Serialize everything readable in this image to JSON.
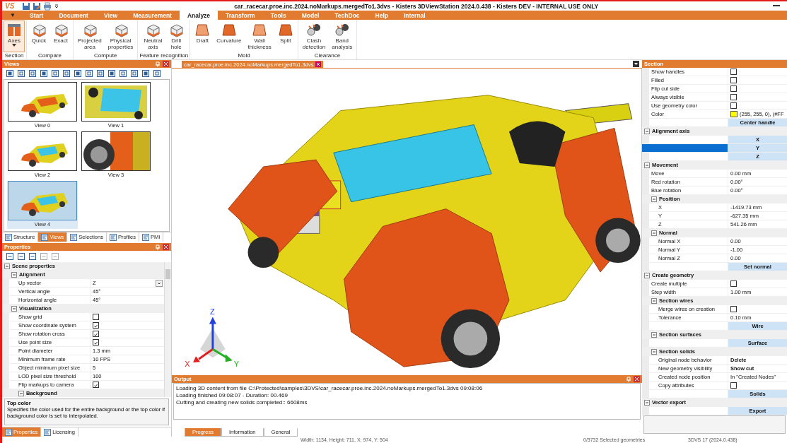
{
  "window": {
    "logo": "VS",
    "title": "car_racecar.proe.inc.2024.noMarkups.mergedTo1.3dvs - Kisters 3DViewStation 2024.0.438 - Kisters DEV - INTERNAL USE ONLY"
  },
  "menu": {
    "app_menu": "▼",
    "tabs": [
      {
        "label": "Start",
        "selected": false
      },
      {
        "label": "Document",
        "selected": false
      },
      {
        "label": "View",
        "selected": false
      },
      {
        "label": "Measurement",
        "selected": false
      },
      {
        "label": "Analyze",
        "selected": true
      },
      {
        "label": "Transform",
        "selected": false
      },
      {
        "label": "Tools",
        "selected": false
      },
      {
        "label": "Model",
        "selected": false
      },
      {
        "label": "TechDoc",
        "selected": false
      },
      {
        "label": "Help",
        "selected": false
      },
      {
        "label": "Internal",
        "selected": false
      }
    ]
  },
  "ribbon": [
    {
      "label": "Section",
      "buttons": [
        {
          "label": "Axes",
          "dropdown": true,
          "selected": true
        }
      ]
    },
    {
      "label": "Compare",
      "buttons": [
        {
          "label": "Quick",
          "dropdown": false,
          "selected": false
        },
        {
          "label": "Exact",
          "dropdown": false,
          "selected": false
        }
      ]
    },
    {
      "label": "Compute",
      "buttons": [
        {
          "label": "Projected\narea",
          "dropdown": false,
          "selected": false
        },
        {
          "label": "Physical\nproperties",
          "dropdown": false,
          "selected": false
        }
      ]
    },
    {
      "label": "Feature recognition",
      "buttons": [
        {
          "label": "Neutral\naxis",
          "dropdown": false,
          "selected": false
        },
        {
          "label": "Drill\nhole",
          "dropdown": false,
          "selected": false
        }
      ]
    },
    {
      "label": "Mold",
      "buttons": [
        {
          "label": "Draft",
          "dropdown": false,
          "selected": false
        },
        {
          "label": "Curvature",
          "dropdown": false,
          "selected": false
        },
        {
          "label": "Wall\nthickness",
          "dropdown": false,
          "selected": false
        },
        {
          "label": "Split",
          "dropdown": false,
          "selected": false
        }
      ]
    },
    {
      "label": "Clearance",
      "buttons": [
        {
          "label": "Clash\ndetection",
          "dropdown": false,
          "selected": false
        },
        {
          "label": "Band\nanalysis",
          "dropdown": false,
          "selected": false
        }
      ]
    }
  ],
  "views": {
    "title": "Views",
    "thumbnails": [
      {
        "label": "View 0",
        "selected": false
      },
      {
        "label": "View 1",
        "selected": false
      },
      {
        "label": "View 2",
        "selected": false
      },
      {
        "label": "View 3",
        "selected": false
      },
      {
        "label": "View 4",
        "selected": true
      }
    ]
  },
  "left_tabs": [
    {
      "label": "Structure",
      "selected": false
    },
    {
      "label": "Views",
      "selected": true
    },
    {
      "label": "Selections",
      "selected": false
    },
    {
      "label": "Profiles",
      "selected": false
    },
    {
      "label": "PMI",
      "selected": false
    }
  ],
  "properties": {
    "title": "Properties",
    "items": [
      {
        "kind": "group",
        "label": "Scene properties",
        "expanded": true,
        "children": [
          {
            "kind": "group",
            "label": "Alignment",
            "expanded": true,
            "children": [
              {
                "kind": "select",
                "label": "Up vector",
                "value": "Z"
              },
              {
                "kind": "value",
                "label": "Vertical angle",
                "value": "45°",
                "emphasized": false
              },
              {
                "kind": "value",
                "label": "Horizontal angle",
                "value": "45°",
                "emphasized": false
              }
            ]
          },
          {
            "kind": "group",
            "label": "Visualization",
            "expanded": true,
            "children": [
              {
                "kind": "check",
                "label": "Show grid",
                "checked": false
              },
              {
                "kind": "check",
                "label": "Show coordinate system",
                "checked": true
              },
              {
                "kind": "check",
                "label": "Show rotation cross",
                "checked": true
              },
              {
                "kind": "check",
                "label": "Use point size",
                "checked": true
              },
              {
                "kind": "value",
                "label": "Point diameter",
                "value": "1.3 mm",
                "emphasized": false
              },
              {
                "kind": "value",
                "label": "Minimum frame rate",
                "value": "10 FPS",
                "emphasized": false
              },
              {
                "kind": "value",
                "label": "Object minimum pixel size",
                "value": "5",
                "emphasized": false
              },
              {
                "kind": "value",
                "label": "LOD pixel size threshold",
                "value": "100",
                "emphasized": false
              },
              {
                "kind": "check",
                "label": "Flip markups to camera",
                "checked": true
              },
              {
                "kind": "group",
                "label": "Background",
                "expanded": true
              }
            ]
          }
        ]
      }
    ],
    "description": {
      "title": "Top color",
      "text": "Specifies the color used for the entire background or the top color if background color is set to interpolated."
    }
  },
  "left_bottom_tabs": [
    {
      "label": "Properties",
      "selected": true
    },
    {
      "label": "Licensing",
      "selected": false
    }
  ],
  "document_tab": {
    "label": "car_racecar.proe.inc.2024.noMarkups.mergedTo1.3dvs"
  },
  "viewport": {
    "axes": {
      "x": "X",
      "y": "Y",
      "z": "Z"
    }
  },
  "output": {
    "title": "Output",
    "lines": [
      "Loading 3D content from file C:\\Protected\\samples\\3DVS\\car_racecar.proe.inc.2024.noMarkups.mergedTo1.3dvs 09:08:06",
      "Loading finished 09:08:07 - Duration: 00.469",
      "Cutting and creating new solids completed:: 6608ms"
    ],
    "tabs": [
      {
        "label": "Progress",
        "selected": true
      },
      {
        "label": "Information",
        "selected": false
      },
      {
        "label": "General",
        "selected": false
      }
    ]
  },
  "section": {
    "title": "Section",
    "items": [
      {
        "kind": "check",
        "label": "Show handles",
        "checked": false
      },
      {
        "kind": "check",
        "label": "Filled",
        "checked": false
      },
      {
        "kind": "check",
        "label": "Flip cut side",
        "checked": false
      },
      {
        "kind": "check",
        "label": "Always visible",
        "checked": false
      },
      {
        "kind": "check",
        "label": "Use geometry color",
        "checked": false
      },
      {
        "kind": "color",
        "label": "Color",
        "color": "#ffff00",
        "value": "(255, 255, 0), (#FF"
      },
      {
        "kind": "button",
        "label": "Center handle"
      },
      {
        "kind": "group",
        "label": "Alignment axis",
        "expanded": true,
        "children": [
          {
            "kind": "axis",
            "label": "X",
            "selected": false
          },
          {
            "kind": "axis",
            "label": "Y",
            "selected": true
          },
          {
            "kind": "axis",
            "label": "Z",
            "selected": false
          }
        ]
      },
      {
        "kind": "group",
        "label": "Movement",
        "expanded": true,
        "children": [
          {
            "kind": "value",
            "label": "Move",
            "value": "0.00 mm",
            "emphasized": false
          },
          {
            "kind": "value",
            "label": "Red rotation",
            "value": "0.00°",
            "emphasized": false
          },
          {
            "kind": "value",
            "label": "Blue rotation",
            "value": "0.00°",
            "emphasized": false
          },
          {
            "kind": "group",
            "label": "Position",
            "expanded": true,
            "children": [
              {
                "kind": "value",
                "label": "X",
                "value": "-1419.73 mm",
                "emphasized": false
              },
              {
                "kind": "value",
                "label": "Y",
                "value": "-627.35 mm",
                "emphasized": false
              },
              {
                "kind": "value",
                "label": "Z",
                "value": "541.26 mm",
                "emphasized": false
              }
            ]
          },
          {
            "kind": "group",
            "label": "Normal",
            "expanded": true,
            "children": [
              {
                "kind": "value",
                "label": "Normal X",
                "value": "0.00",
                "emphasized": false
              },
              {
                "kind": "value",
                "label": "Normal Y",
                "value": "-1.00",
                "emphasized": false
              },
              {
                "kind": "value",
                "label": "Normal Z",
                "value": "0.00",
                "emphasized": false
              },
              {
                "kind": "button",
                "label": "Set normal"
              }
            ]
          }
        ]
      },
      {
        "kind": "group",
        "label": "Create geometry",
        "expanded": true,
        "children": [
          {
            "kind": "check",
            "label": "Create multiple",
            "checked": false
          },
          {
            "kind": "value",
            "label": "Step width",
            "value": "1.00 mm",
            "emphasized": false
          },
          {
            "kind": "group",
            "label": "Section wires",
            "expanded": true,
            "children": [
              {
                "kind": "check",
                "label": "Merge wires on creation",
                "checked": false
              },
              {
                "kind": "value",
                "label": "Tolerance",
                "value": "0.10 mm",
                "emphasized": false
              },
              {
                "kind": "button",
                "label": "Wire"
              }
            ]
          },
          {
            "kind": "group",
            "label": "Section surfaces",
            "expanded": true,
            "children": [
              {
                "kind": "button",
                "label": "Surface"
              }
            ]
          },
          {
            "kind": "group",
            "label": "Section solids",
            "expanded": true,
            "children": [
              {
                "kind": "value",
                "label": "Original node behavior",
                "value": "Delete",
                "emphasized": true
              },
              {
                "kind": "value",
                "label": "New geometry visibility",
                "value": "Show cut",
                "emphasized": true
              },
              {
                "kind": "value",
                "label": "Created node position",
                "value": "In \"Created Nodes\"",
                "emphasized": false
              },
              {
                "kind": "check",
                "label": "Copy attributes",
                "checked": false
              },
              {
                "kind": "button",
                "label": "Solids"
              }
            ]
          }
        ]
      },
      {
        "kind": "group",
        "label": "Vector export",
        "expanded": true,
        "children": [
          {
            "kind": "button",
            "label": "Export"
          }
        ]
      }
    ]
  },
  "status_bar": {
    "size": "Width: 1134, Height: 711, X: 974, Y: 504",
    "selection": "0/3732 Selected geometries",
    "version": "3DVS 17 (2024.0.438)"
  }
}
